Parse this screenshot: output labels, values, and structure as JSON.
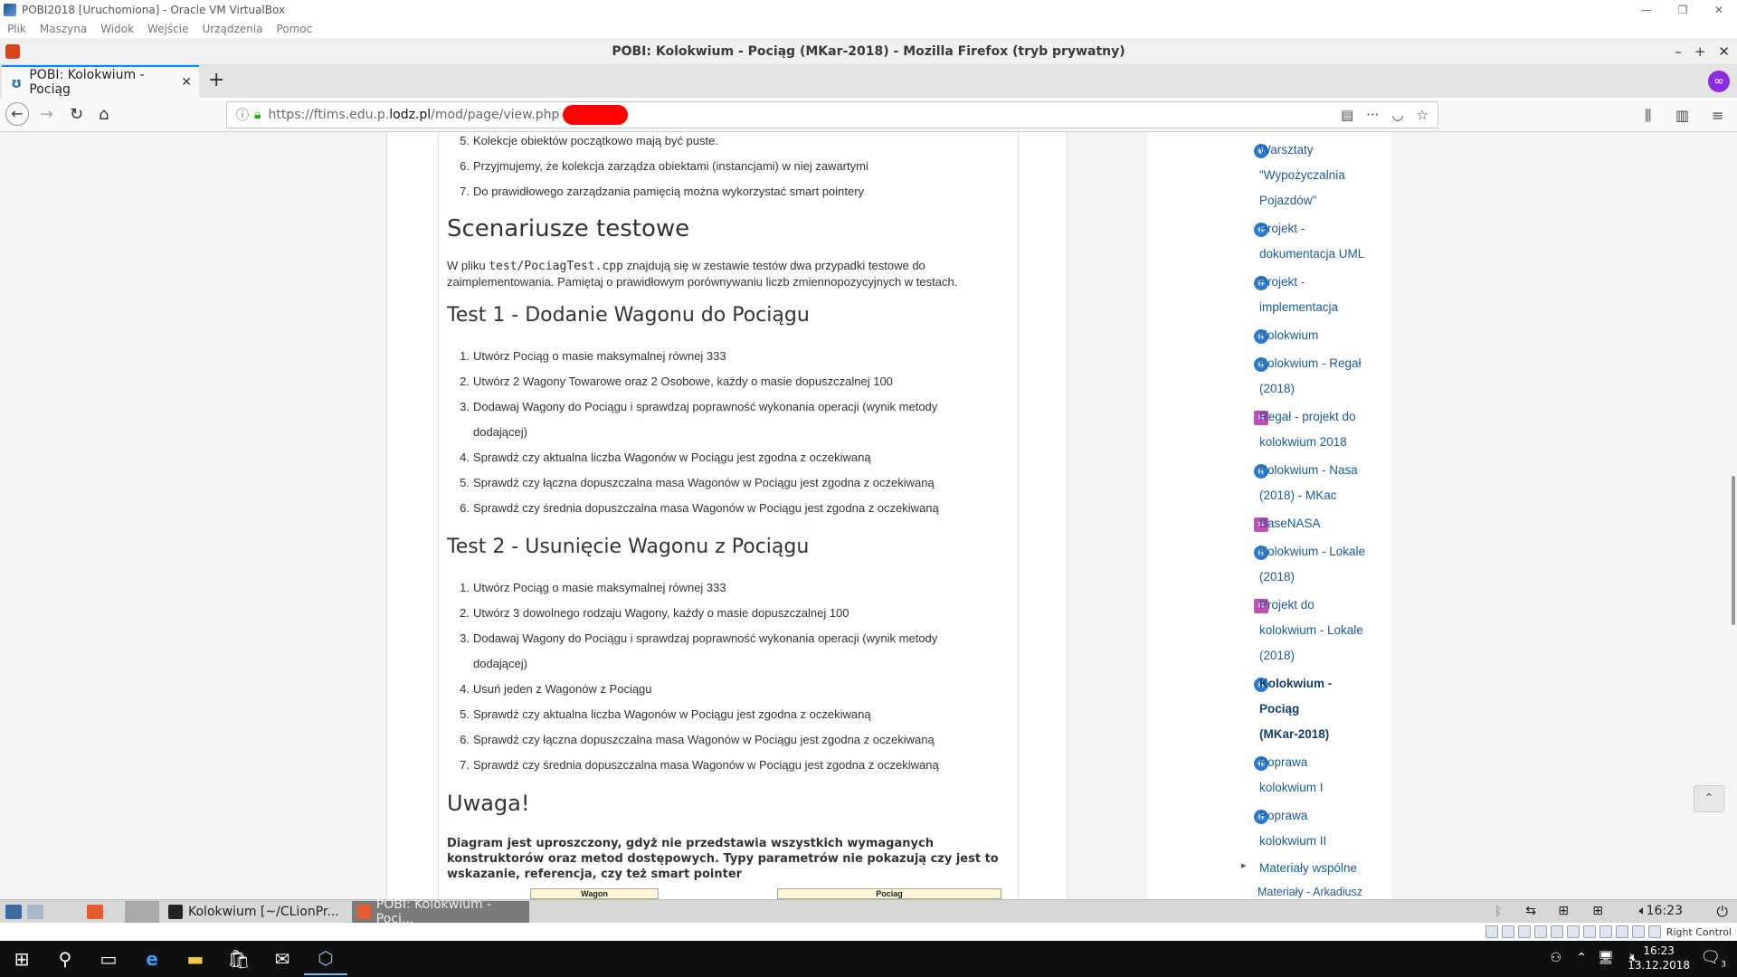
{
  "vbox": {
    "title": "POBI2018 [Uruchomiona] - Oracle VM VirtualBox",
    "menu": [
      "Plik",
      "Maszyna",
      "Widok",
      "Wejście",
      "Urządzenia",
      "Pomoc"
    ],
    "status_right": "Right Control"
  },
  "firefox": {
    "window_title": "POBI: Kolokwium - Pociąg (MKar-2018) - Mozilla Firefox (tryb prywatny)",
    "tab_title": "POBI: Kolokwium - Pociąg",
    "url_prefix": "https://ftims.edu.p.",
    "url_domain": "lodz.pl",
    "url_path": "/mod/page/view.php"
  },
  "content": {
    "intro_items": [
      {
        "num": "5.",
        "text": "Kolekcje obiektów początkowo mają być puste."
      },
      {
        "num": "6.",
        "text": "Przyjmujemy, że kolekcja zarządza obiektami (instancjami) w niej zawartymi"
      },
      {
        "num": "7.",
        "text": "Do prawidłowego zarządzania pamięcią można wykorzystać smart pointery"
      }
    ],
    "h_scenarios": "Scenariusze testowe",
    "scenarios_p1": "W pliku ",
    "scenarios_code": "test/PociagTest.cpp",
    "scenarios_p2": " znajdują się w zestawie testów dwa przypadki testowe do",
    "scenarios_p3": "zaimplementowania. Pamiętaj o prawidłowym porównywaniu liczb zmiennopozycyjnych w testach.",
    "h_test1": "Test 1 - Dodanie Wagonu do Pociągu",
    "test1_items": [
      {
        "num": "1.",
        "text": "Utwórz Pociąg o masie maksymalnej równej 333"
      },
      {
        "num": "2.",
        "text": "Utwórz 2 Wagony Towarowe oraz 2 Osobowe, każdy o masie dopuszczalnej 100"
      },
      {
        "num": "3.",
        "text": "Dodawaj Wagony do Pociągu i sprawdzaj poprawność wykonania operacji (wynik metody"
      },
      {
        "num": "",
        "text": "dodającej)"
      },
      {
        "num": "4.",
        "text": "Sprawdź czy aktualna liczba Wagonów w Pociągu jest zgodna z oczekiwaną"
      },
      {
        "num": "5.",
        "text": "Sprawdź czy łączna dopuszczalna masa Wagonów w Pociągu jest zgodna z oczekiwaną"
      },
      {
        "num": "6.",
        "text": "Sprawdź czy średnia dopuszczalna masa Wagonów w Pociągu jest zgodna z oczekiwaną"
      }
    ],
    "h_test2": "Test 2 - Usunięcie Wagonu z Pociągu",
    "test2_items": [
      {
        "num": "1.",
        "text": "Utwórz Pociąg o masie maksymalnej równej 333"
      },
      {
        "num": "2.",
        "text": "Utwórz 3 dowolnego rodzaju Wagony, każdy o masie dopuszczalnej 100"
      },
      {
        "num": "3.",
        "text": "Dodawaj Wagony do Pociągu i sprawdzaj poprawność wykonania operacji (wynik metody"
      },
      {
        "num": "",
        "text": "dodającej)"
      },
      {
        "num": "4.",
        "text": "Usuń jeden z Wagonów z Pociągu"
      },
      {
        "num": "5.",
        "text": "Sprawdź czy aktualna liczba Wagonów w Pociągu jest zgodna z oczekiwaną"
      },
      {
        "num": "6.",
        "text": "Sprawdź czy łączna dopuszczalna masa Wagonów w Pociągu jest zgodna z oczekiwaną"
      },
      {
        "num": "7.",
        "text": "Sprawdź czy średnia dopuszczalna masa Wagonów w Pociągu jest zgodna z oczekiwaną"
      }
    ],
    "h_uwaga": "Uwaga!",
    "uwaga_text": "Diagram jest uproszczony, gdyż nie przedstawia wszystkich wymaganych konstruktorów oraz metod dostępowych. Typy parametrów nie pokazują czy jest to wskazanie, referencja, czy też smart pointer",
    "uml_wagon": "Wagon",
    "uml_pociag": "Pociag"
  },
  "sidebar": {
    "items": [
      {
        "lines": [
          "Warsztaty",
          "\"Wypożyczalnia",
          "Pojazdów\""
        ],
        "icon": "page-icon"
      },
      {
        "lines": [
          "Projekt -",
          "dokumentacja UML"
        ],
        "icon": "assignment-icon"
      },
      {
        "lines": [
          "Projekt -",
          "implementacja"
        ],
        "icon": "assignment-icon"
      },
      {
        "lines": [
          "Kolokwium"
        ],
        "icon": "assignment-icon"
      },
      {
        "lines": [
          "Kolokwium - Regał",
          "(2018)"
        ],
        "icon": "page-icon"
      },
      {
        "lines": [
          "Regał - projekt do",
          "kolokwium 2018"
        ],
        "icon": "file-icon"
      },
      {
        "lines": [
          "Kolokwium - Nasa",
          "(2018) - MKac"
        ],
        "icon": "page-icon"
      },
      {
        "lines": [
          "BaseNASA"
        ],
        "icon": "file-icon"
      },
      {
        "lines": [
          "Kolokwium - Lokale",
          "(2018)"
        ],
        "icon": "page-icon"
      },
      {
        "lines": [
          "Projekt do",
          "kolokwium - Lokale",
          "(2018)"
        ],
        "icon": "file-icon"
      },
      {
        "lines": [
          "Kolokwium -",
          "Pociąg",
          "(MKar-2018)"
        ],
        "icon": "page-icon",
        "active": true
      },
      {
        "lines": [
          "Poprawa",
          "kolokwium I"
        ],
        "icon": "assignment-icon"
      },
      {
        "lines": [
          "Poprawa",
          "kolokwium II"
        ],
        "icon": "assignment-icon"
      }
    ],
    "section": "Materiały wspólne",
    "cut_item": "Materiały - Arkadiusz"
  },
  "guest_taskbar": {
    "task1": "Kolokwium [~/CLionPr...",
    "task2": "POBI: Kolokwium - Poci...",
    "clock": "16:23"
  },
  "windows_taskbar": {
    "time": "16:23",
    "date": "13.12.2018",
    "notif_count": "3"
  }
}
